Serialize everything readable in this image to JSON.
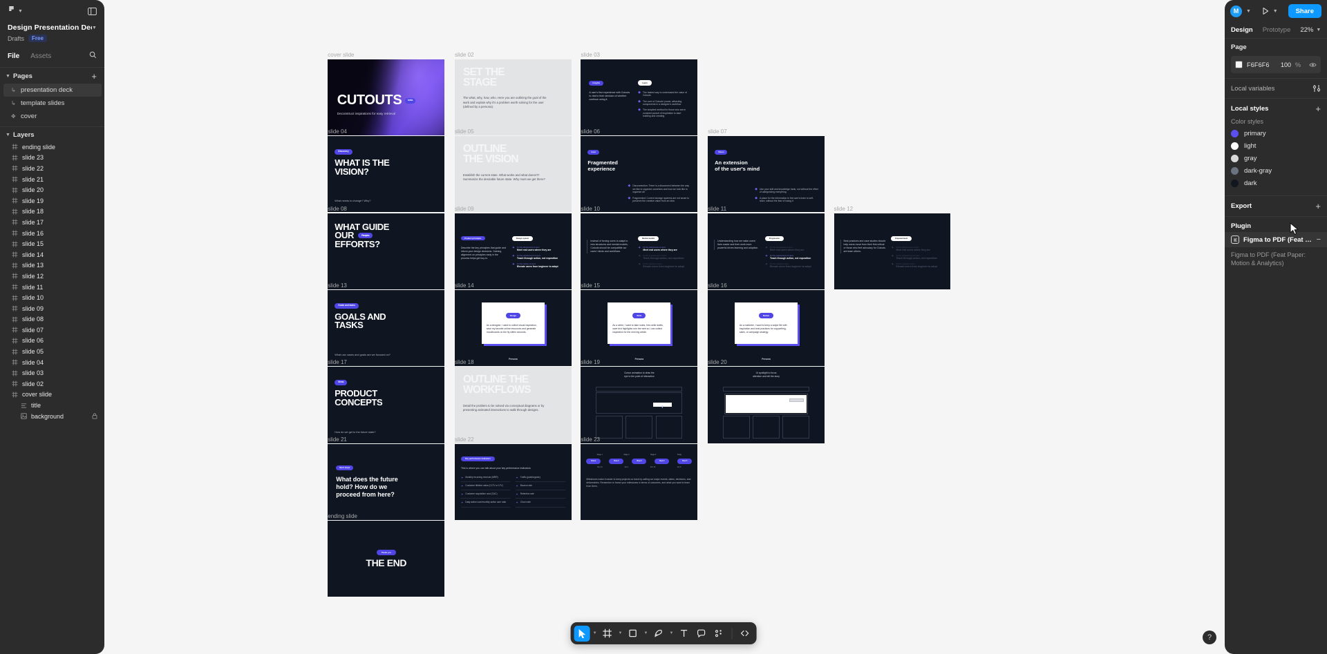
{
  "left_panel": {
    "file_title": "Design Presentation Deck (…",
    "drafts": "Drafts",
    "plan_badge": "Free",
    "tabs": [
      {
        "label": "File",
        "active": true
      },
      {
        "label": "Assets",
        "active": false
      }
    ],
    "search_icon": "search-icon",
    "pages_section": {
      "title": "Pages",
      "add_icon": "plus-icon"
    },
    "pages": [
      {
        "label": "presentation deck",
        "selected": true
      },
      {
        "label": "template slides",
        "selected": false
      },
      {
        "label": "cover",
        "selected": false,
        "type": "component"
      }
    ],
    "layers_section": {
      "title": "Layers"
    },
    "layers": [
      {
        "label": "ending slide",
        "indent": 0
      },
      {
        "label": "slide 23",
        "indent": 0
      },
      {
        "label": "slide 22",
        "indent": 0
      },
      {
        "label": "slide 21",
        "indent": 0
      },
      {
        "label": "slide 20",
        "indent": 0
      },
      {
        "label": "slide 19",
        "indent": 0
      },
      {
        "label": "slide 18",
        "indent": 0
      },
      {
        "label": "slide 17",
        "indent": 0
      },
      {
        "label": "slide 16",
        "indent": 0
      },
      {
        "label": "slide 15",
        "indent": 0
      },
      {
        "label": "slide 14",
        "indent": 0
      },
      {
        "label": "slide 13",
        "indent": 0
      },
      {
        "label": "slide 12",
        "indent": 0
      },
      {
        "label": "slide 11",
        "indent": 0
      },
      {
        "label": "slide 10",
        "indent": 0
      },
      {
        "label": "slide 09",
        "indent": 0
      },
      {
        "label": "slide 08",
        "indent": 0
      },
      {
        "label": "slide 07",
        "indent": 0
      },
      {
        "label": "slide 06",
        "indent": 0
      },
      {
        "label": "slide 05",
        "indent": 0
      },
      {
        "label": "slide 04",
        "indent": 0
      },
      {
        "label": "slide 03",
        "indent": 0
      },
      {
        "label": "slide 02",
        "indent": 0
      },
      {
        "label": "cover slide",
        "indent": 0
      },
      {
        "label": "title",
        "indent": 1,
        "icon": "text-icon"
      },
      {
        "label": "background",
        "indent": 1,
        "icon": "image-icon",
        "locked": true
      }
    ]
  },
  "right_panel": {
    "avatar_initial": "M",
    "present_icon": "play-icon",
    "share_label": "Share",
    "tabs": [
      {
        "label": "Design",
        "active": true
      },
      {
        "label": "Prototype",
        "active": false
      }
    ],
    "zoom_level": "22%",
    "page_section": {
      "title": "Page",
      "color_hex": "F6F6F6",
      "opacity": "100",
      "unit": "%",
      "swatch": "#F6F6F6"
    },
    "local_variables": {
      "title": "Local variables",
      "icon": "sliders-icon"
    },
    "local_styles": {
      "title": "Local styles",
      "add_icon": "plus-icon"
    },
    "color_styles_label": "Color styles",
    "color_styles": [
      {
        "name": "primary",
        "color": "#5b4ff0"
      },
      {
        "name": "light",
        "color": "#ffffff"
      },
      {
        "name": "gray",
        "color": "#d9d9d9"
      },
      {
        "name": "dark-gray",
        "color": "#6b7280"
      },
      {
        "name": "dark",
        "color": "#11161f"
      }
    ],
    "export": {
      "title": "Export",
      "add_icon": "plus-icon"
    },
    "plugin": {
      "title": "Plugin",
      "item_name": "Figma to PDF (Feat Paper: …",
      "item_desc": "Figma to PDF (Feat Paper: Motion & Analytics)",
      "remove_icon": "minus-icon"
    }
  },
  "toolbar": {
    "tools": [
      {
        "name": "move-tool",
        "glyph": "cursor",
        "active": true,
        "has_chevron": true
      },
      {
        "name": "frame-tool",
        "glyph": "frame",
        "active": false,
        "has_chevron": true
      },
      {
        "name": "shape-tool",
        "glyph": "square",
        "active": false,
        "has_chevron": true
      },
      {
        "name": "pen-tool",
        "glyph": "pen",
        "active": false,
        "has_chevron": true
      },
      {
        "name": "text-tool",
        "glyph": "text",
        "active": false,
        "has_chevron": false
      },
      {
        "name": "comment-tool",
        "glyph": "comment",
        "active": false,
        "has_chevron": false
      },
      {
        "name": "actions-tool",
        "glyph": "actions",
        "active": false,
        "has_chevron": false
      },
      {
        "name": "dev-mode-tool",
        "glyph": "code",
        "active": false,
        "has_chevron": false
      }
    ],
    "help_label": "?"
  },
  "canvas": {
    "slides": [
      {
        "id": "cover",
        "label": "cover slide",
        "kind": "cover",
        "title": "CUTOUTS",
        "subtitle": "Deconstruct inspirations for easy retrieval",
        "badge": "beta"
      },
      {
        "id": "s02",
        "label": "slide 02",
        "kind": "light-title",
        "title_lines": [
          "SET THE",
          "STAGE"
        ],
        "body": "The what, why, how, who. Here you are outlining the goal of the work and explain why it's a problem worth solving for the user (defined by a persona)."
      },
      {
        "id": "s03",
        "label": "slide 03",
        "kind": "two-col-bullets",
        "left_pill": "Insights",
        "right_pill": "Learn",
        "left_body": "A user's first experience with Cutouts is vital to their decision of whether continue using it.",
        "bullets": [
          "The fastest way to understand the value of Cutouts",
          "The core of Cutouts' power, attracting components in a designer's workflow",
          "The simplest method for those who are in constant pursuit of inspiration to start building and creating"
        ]
      },
      {
        "id": "s04",
        "label": "slide 04",
        "kind": "section-title",
        "pill": "Discovery",
        "title_lines": [
          "WHAT IS THE",
          "VISION?"
        ],
        "footer": "What needs to change? Why?"
      },
      {
        "id": "s05",
        "label": "slide 05",
        "kind": "light-title",
        "title_lines": [
          "OUTLINE",
          "THE VISION"
        ],
        "body": "Establish the current state. What works and what doesn't? Summarize the desirable future state. Why must we get there?"
      },
      {
        "id": "s06",
        "label": "slide 06",
        "kind": "headline-bullets",
        "pill": "Goal",
        "title_lines": [
          "Fragmented",
          "experience"
        ],
        "bullets": [
          "Disconnection: There is a disconnect between the way we like to organize ourselves and how we look like to organize all",
          "Fragmented: Current storage systems are not smart to preserve the creative value from an idea"
        ]
      },
      {
        "id": "s07",
        "label": "slide 07",
        "kind": "headline-bullets",
        "pill": "Vision",
        "title_lines": [
          "An extension",
          "of the user's mind"
        ],
        "bullets": [
          "Use your skill and knowledge bank, not without the effort of categorizing everything",
          "A place for the information in the user's brain to self-store, without the fear of losing it"
        ]
      },
      {
        "id": "s08",
        "label": "slide 08",
        "kind": "section-title-inline",
        "pill": "Principles",
        "title_lines": [
          "WHAT GUIDE",
          "OUR",
          "EFFORTS?"
        ]
      },
      {
        "id": "s09",
        "label": "slide 09",
        "kind": "principles",
        "pill": "Product principles",
        "right_pill": "Design system",
        "body": "Describe the key principles that guide and inform your design decisions. Gaining alignment on principles early in the process helps get buy-in.",
        "items": [
          {
            "kicker": "For the effectiveness of users",
            "title": "Meet real users where they are"
          },
          {
            "kicker": "For the empowerment of users",
            "title": "Teach through action, not exposition"
          },
          {
            "kicker": "For the mastery of users",
            "title": "Elevate users from beginner to adept"
          }
        ]
      },
      {
        "id": "s10",
        "label": "slide 10",
        "kind": "principles",
        "right_pill": "Mental models",
        "body": "Instead of forcing users to adapt to new structures and mental models, Cutouts should be compatible our users' minds and workflows.",
        "items": [
          {
            "kicker": "For the effectiveness of users",
            "title": "Meet real users where they are",
            "dim": false
          },
          {
            "kicker": "For the empowerment of users",
            "title": "Teach through action, not exposition",
            "dim": true
          },
          {
            "kicker": "For the mastery of users",
            "title": "Elevate users from beginner to adept",
            "dim": true
          }
        ]
      },
      {
        "id": "s11",
        "label": "slide 11",
        "kind": "principles",
        "right_pill": "Progression",
        "body": "Understanding how we make users' lives easier and their work more powerful drives learning and adoption.",
        "items": [
          {
            "kicker": "For the effectiveness of users",
            "title": "Meet real users where they are",
            "dim": true
          },
          {
            "kicker": "For the empowerment of users",
            "title": "Teach through action, not exposition",
            "dim": false
          },
          {
            "kicker": "For the mastery of users",
            "title": "Elevate users from beginner to adept",
            "dim": true
          }
        ]
      },
      {
        "id": "s12",
        "label": "slide 12",
        "kind": "principles",
        "right_pill": "Empowerment",
        "body": "Best practices and case studies should help users move from their first critical or those who feel advocacy for Cutouts are team others.",
        "items": [
          {
            "kicker": "For the effectiveness of users",
            "title": "Meet real users where they are",
            "dim": true
          },
          {
            "kicker": "For the empowerment of users",
            "title": "Teach through action, not exposition",
            "dim": true
          },
          {
            "kicker": "For the mastery of users",
            "title": "Elevate users from beginner to adept",
            "dim": true
          }
        ]
      },
      {
        "id": "s13",
        "label": "slide 13",
        "kind": "section-title",
        "pill": "Goals and tasks",
        "title_lines": [
          "GOALS AND",
          "TASKS"
        ],
        "footer": "What use cases and goals are we focused on?"
      },
      {
        "id": "s14",
        "label": "slide 14",
        "kind": "quote",
        "pill": "Design",
        "quote": "As a designer, I want to collect visual inspiration, save my favorite online resources and generate moodboards on the fly within seconds.",
        "caption": "Persona"
      },
      {
        "id": "s15",
        "label": "slide 15",
        "kind": "quote",
        "pill": "Write",
        "quote": "As a writer, I want to take notes, free-write drafts, save text highlights rom the web so I can collect inspiration for the next big article.",
        "caption": "Persona"
      },
      {
        "id": "s16",
        "label": "slide 16",
        "kind": "quote",
        "pill": "Market",
        "quote": "As a marketer, I want to keep a swipe file with inspiration and best practices for copywriting, sales, or campaign strategy.",
        "caption": "Persona"
      },
      {
        "id": "s17",
        "label": "slide 17",
        "kind": "section-title",
        "pill": "Ideas",
        "title_lines": [
          "PRODUCT",
          "CONCEPTS"
        ],
        "footer": "How do we get to the future state?"
      },
      {
        "id": "s18",
        "label": "slide 18",
        "kind": "light-title",
        "title_lines": [
          "OUTLINE THE",
          "WORKFLOWS"
        ],
        "body": "Detail the problem to be solved via conceptual diagrams or by presenting animated interactions to walk through designs."
      },
      {
        "id": "s19",
        "label": "slide 19",
        "kind": "wireframe-cursor",
        "caption_lines": [
          "Cursor animation to draw the",
          "eye to the point of interaction"
        ]
      },
      {
        "id": "s20",
        "label": "slide 20",
        "kind": "wireframe-spotlight",
        "caption_lines": [
          "UI spotlight to focus",
          "attention and tell the story"
        ]
      },
      {
        "id": "s21",
        "label": "slide 21",
        "kind": "section-title-serif",
        "pill": "Next steps",
        "title_lines": [
          "What does the future",
          "hold? How do we",
          "proceed from here?"
        ]
      },
      {
        "id": "s22",
        "label": "slide 22",
        "kind": "kpi",
        "pill": "Key performance indicators",
        "body": "This is where you can talk about your key performance indicators",
        "left_items": [
          "Monthly recurring revenue (MRR)",
          "Customer lifetime value (CLTV or LTV)",
          "Customer acquisition cost (CAC)",
          "Daily active user/monthly active user ratio"
        ],
        "right_items": [
          "Traffic (paid/organic)",
          "Bounce rate",
          "Retention rate",
          "Churn rate"
        ]
      },
      {
        "id": "s23",
        "label": "slide 23",
        "kind": "timeline",
        "stages": [
          "Stage 1",
          "Stage 2",
          "Stage 3",
          "Today"
        ],
        "nodes": [
          "Now 1",
          "Now 2",
          "Now 3",
          "Now 4",
          "Now 5"
        ],
        "sublabels": [
          "Nov 21",
          "Jan 4",
          "Feb 19",
          "Apr 5"
        ],
        "body": "Milestones make it easier to keep projects on track by calling out major events, dates, decisions, and deliverables. Remember to frame your milestones in terms of outcomes, and what you want to learn from them."
      },
      {
        "id": "ending",
        "label": "ending slide",
        "kind": "end",
        "pill": "Thank you",
        "title": "THE END"
      }
    ]
  }
}
